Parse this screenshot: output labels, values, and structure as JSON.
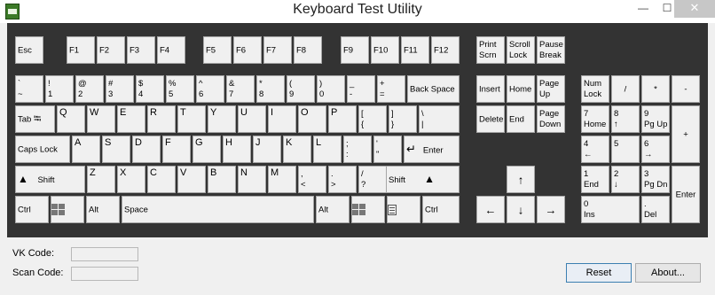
{
  "window": {
    "title": "Keyboard Test Utility",
    "min": "—",
    "max": "☐",
    "close": "✕"
  },
  "keys": {
    "esc": "Esc",
    "f1": "F1",
    "f2": "F2",
    "f3": "F3",
    "f4": "F4",
    "f5": "F5",
    "f6": "F6",
    "f7": "F7",
    "f8": "F8",
    "f9": "F9",
    "f10": "F10",
    "f11": "F11",
    "f12": "F12",
    "print_scrn_1": "Print",
    "print_scrn_2": "Scrn",
    "scroll_lock_1": "Scroll",
    "scroll_lock_2": "Lock",
    "pause_1": "Pause",
    "pause_2": "Break",
    "backtick": {
      "top": "`",
      "bot": "~"
    },
    "d1": {
      "top": "!",
      "bot": "1"
    },
    "d2": {
      "top": "@",
      "bot": "2"
    },
    "d3": {
      "top": "#",
      "bot": "3"
    },
    "d4": {
      "top": "$",
      "bot": "4"
    },
    "d5": {
      "top": "%",
      "bot": "5"
    },
    "d6": {
      "top": "^",
      "bot": "6"
    },
    "d7": {
      "top": "&",
      "bot": "7"
    },
    "d8": {
      "top": "*",
      "bot": "8"
    },
    "d9": {
      "top": "(",
      "bot": "9"
    },
    "d0": {
      "top": ")",
      "bot": "0"
    },
    "minus": {
      "top": "_",
      "bot": "-"
    },
    "equals": {
      "top": "+",
      "bot": "="
    },
    "backspace": "Back Space",
    "tab": "Tab",
    "q": "Q",
    "w": "W",
    "e": "E",
    "r": "R",
    "t": "T",
    "y": "Y",
    "u": "U",
    "i": "I",
    "o": "O",
    "p": "P",
    "lbracket": {
      "top": "[",
      "bot": "{"
    },
    "rbracket": {
      "top": "]",
      "bot": "}"
    },
    "backslash": {
      "top": "\\",
      "bot": "|"
    },
    "caps": "Caps Lock",
    "a": "A",
    "s": "S",
    "d": "D",
    "f": "F",
    "g": "G",
    "h": "H",
    "j": "J",
    "k": "K",
    "l": "L",
    "semicolon": {
      "top": ";",
      "bot": ":"
    },
    "quote": {
      "top": "'",
      "bot": "\""
    },
    "enter": "Enter",
    "lshift": "Shift",
    "z": "Z",
    "x": "X",
    "c": "C",
    "v": "V",
    "b": "B",
    "n": "N",
    "m": "M",
    "comma": {
      "top": ",",
      "bot": "<"
    },
    "period": {
      "top": ".",
      "bot": ">"
    },
    "slash": {
      "top": "/",
      "bot": "?"
    },
    "rshift": "Shift",
    "lctrl": "Ctrl",
    "lalt": "Alt",
    "space": "Space",
    "ralt": "Alt",
    "rctrl": "Ctrl",
    "insert": "Insert",
    "home": "Home",
    "pageup_1": "Page",
    "pageup_2": "Up",
    "delete": "Delete",
    "end": "End",
    "pagedown_1": "Page",
    "pagedown_2": "Down",
    "up_arrow": "↑",
    "left_arrow": "←",
    "down_arrow": "↓",
    "right_arrow": "→",
    "numlock_1": "Num",
    "numlock_2": "Lock",
    "num_div": "/",
    "num_mul": "*",
    "num_minus": "-",
    "num_plus": "+",
    "num7": {
      "top": "7",
      "bot": "Home"
    },
    "num8": {
      "top": "8",
      "bot": "↑"
    },
    "num9": {
      "top": "9",
      "bot": "Pg Up"
    },
    "num4": {
      "top": "4",
      "bot": "←"
    },
    "num5": {
      "top": "5",
      "bot": ""
    },
    "num6": {
      "top": "6",
      "bot": "→"
    },
    "num1": {
      "top": "1",
      "bot": "End"
    },
    "num2": {
      "top": "2",
      "bot": "↓"
    },
    "num3": {
      "top": "3",
      "bot": "Pg Dn"
    },
    "num0": {
      "top": "0",
      "bot": "Ins"
    },
    "num_dot": {
      "top": ".",
      "bot": "Del"
    },
    "num_enter": "Enter"
  },
  "glyphs": {
    "tab": "⭾",
    "enter": "↵",
    "shift": "▲"
  },
  "info": {
    "vk_label": "VK Code:",
    "vk_value": "",
    "scan_label": "Scan Code:",
    "scan_value": ""
  },
  "buttons": {
    "reset": "Reset",
    "about": "About..."
  }
}
